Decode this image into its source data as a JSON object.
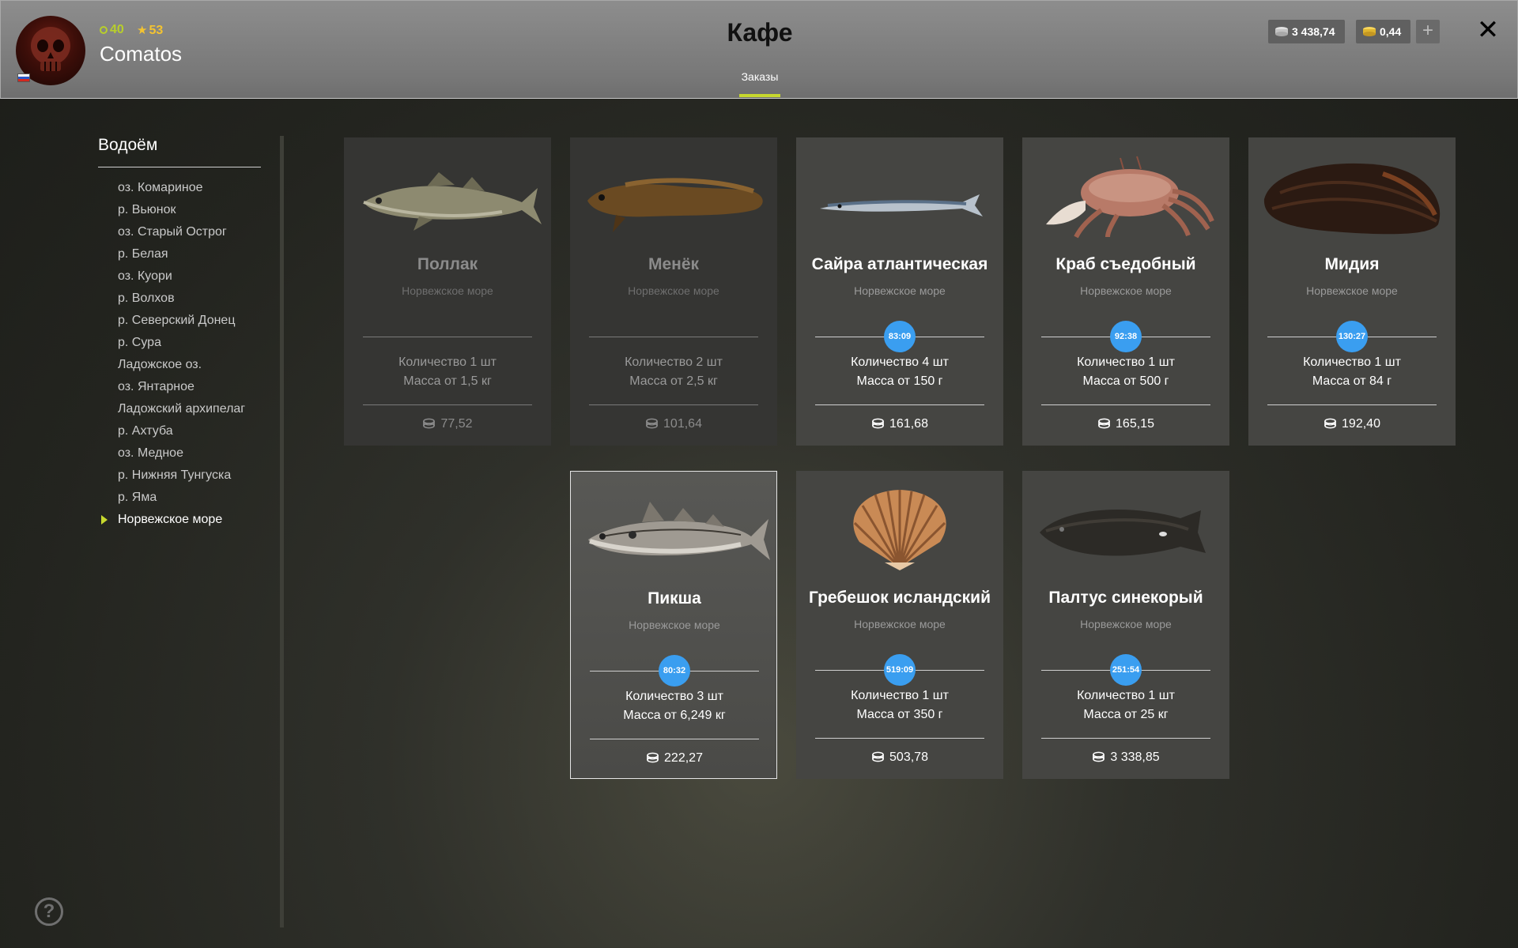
{
  "player": {
    "level": "40",
    "rank": "53",
    "name": "Comatos"
  },
  "header": {
    "title": "Кафе",
    "tab_label": "Заказы",
    "silver": "3 438,74",
    "gold": "0,44",
    "accent_color": "#c7d82e"
  },
  "sidebar": {
    "title": "Водоём",
    "items": [
      "оз. Комариное",
      "р. Вьюнок",
      "оз. Старый Острог",
      "р. Белая",
      "оз. Куори",
      "р. Волхов",
      "р. Северский Донец",
      "р. Сура",
      "Ладожское оз.",
      "оз. Янтарное",
      "Ладожский архипелаг",
      "р. Ахтуба",
      "оз. Медное",
      "р. Нижняя Тунгуска",
      "р. Яма",
      "Норвежское море"
    ],
    "active_index": 15
  },
  "orders": [
    {
      "name": "Поллак",
      "location": "Норвежское море",
      "timer": "",
      "quantity": "Количество 1 шт",
      "mass": "Масса от 1,5 кг",
      "price": "77,52",
      "state": "disabled",
      "icon": "pollock-icon"
    },
    {
      "name": "Менёк",
      "location": "Норвежское море",
      "timer": "",
      "quantity": "Количество 2 шт",
      "mass": "Масса от 2,5 кг",
      "price": "101,64",
      "state": "disabled",
      "icon": "tusk-fish-icon"
    },
    {
      "name": "Сайра атлантическая",
      "location": "Норвежское море",
      "timer": "83:09",
      "quantity": "Количество 4 шт",
      "mass": "Масса от 150 г",
      "price": "161,68",
      "state": "active",
      "icon": "saury-icon"
    },
    {
      "name": "Краб съедобный",
      "location": "Норвежское море",
      "timer": "92:38",
      "quantity": "Количество 1 шт",
      "mass": "Масса от 500 г",
      "price": "165,15",
      "state": "active",
      "icon": "crab-icon"
    },
    {
      "name": "Мидия",
      "location": "Норвежское море",
      "timer": "130:27",
      "quantity": "Количество 1 шт",
      "mass": "Масса от 84 г",
      "price": "192,40",
      "state": "active",
      "icon": "mussel-icon"
    },
    {
      "name": "Пикша",
      "location": "Норвежское море",
      "timer": "80:32",
      "quantity": "Количество 3 шт",
      "mass": "Масса от 6,249 кг",
      "price": "222,27",
      "state": "selected",
      "icon": "haddock-icon"
    },
    {
      "name": "Гребешок исландский",
      "location": "Норвежское море",
      "timer": "519:09",
      "quantity": "Количество 1 шт",
      "mass": "Масса от 350 г",
      "price": "503,78",
      "state": "active",
      "icon": "scallop-icon"
    },
    {
      "name": "Палтус синекорый",
      "location": "Норвежское море",
      "timer": "251:54",
      "quantity": "Количество 1 шт",
      "mass": "Масса от 25 кг",
      "price": "3 338,85",
      "state": "active",
      "icon": "halibut-icon"
    }
  ],
  "colors": {
    "timer": "#3a9ef0",
    "level": "#b8cf2a",
    "rank": "#f3c331"
  }
}
